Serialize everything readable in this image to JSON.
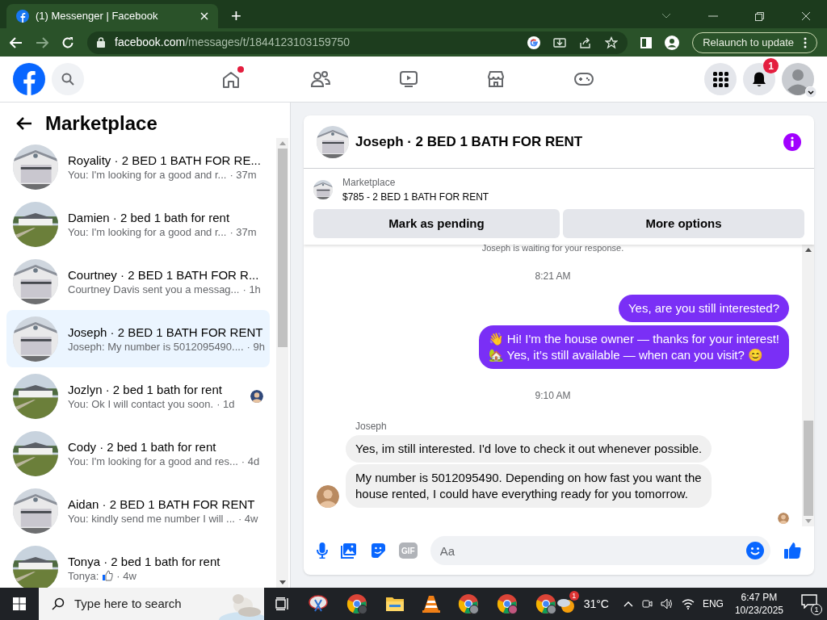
{
  "browser": {
    "tab_title": "(1) Messenger | Facebook",
    "new_tab": "+",
    "url_host": "facebook.com",
    "url_path": "/messages/t/1844123103159750",
    "relaunch": "Relaunch to update"
  },
  "header": {
    "notification_count": "1"
  },
  "sidebar": {
    "title": "Marketplace",
    "conversations": [
      {
        "title": "Royality · 2 BED 1 BATH FOR RE...",
        "preview": "You: I'm looking for a good and r...",
        "time": "· 37m",
        "selected": false,
        "read_receipt": false
      },
      {
        "title": "Damien · 2 bed 1 bath for rent",
        "preview": "You: I'm looking for a good and r...",
        "time": "· 37m",
        "selected": false,
        "read_receipt": false
      },
      {
        "title": "Courtney · 2 BED 1 BATH FOR R...",
        "preview": "Courtney Davis sent you a messag...",
        "time": "· 1h",
        "selected": false,
        "read_receipt": false
      },
      {
        "title": "Joseph · 2 BED 1 BATH FOR RENT",
        "preview": "Joseph: My number is 5012095490....",
        "time": "· 9h",
        "selected": true,
        "read_receipt": false
      },
      {
        "title": "Jozlyn · 2 bed 1 bath for rent",
        "preview": "You: Ok I will contact you soon.",
        "time": "· 1d",
        "selected": false,
        "read_receipt": true
      },
      {
        "title": "Cody · 2 bed 1 bath for rent",
        "preview": "You: I'm looking for a good and res...",
        "time": "· 4d",
        "selected": false,
        "read_receipt": false
      },
      {
        "title": "Aidan · 2 BED 1 BATH FOR RENT",
        "preview": "You: kindly send me number I will ...",
        "time": "· 4w",
        "selected": false,
        "read_receipt": false
      },
      {
        "title": "Tonya · 2 bed 1 bath for rent",
        "preview": "Tonya:",
        "kind": "like",
        "time": "· 4w",
        "selected": false,
        "read_receipt": false
      }
    ]
  },
  "chat": {
    "title": "Joseph · 2 BED 1 BATH FOR RENT",
    "listing": {
      "label": "Marketplace",
      "title": "$785 - 2 BED 1 BATH FOR RENT",
      "buttons": [
        "Mark as pending",
        "More options"
      ]
    },
    "messages": [
      {
        "kind": "notice",
        "text": "Joseph is waiting for your response."
      },
      {
        "kind": "time",
        "text": "8:21 AM"
      },
      {
        "kind": "out",
        "lines": [
          "Yes, are you still interested?"
        ]
      },
      {
        "kind": "out",
        "lines": [
          "👋 Hi! I'm the house owner — thanks for your interest!",
          "🏡 Yes, it’s still available — when can you visit? 😊"
        ]
      },
      {
        "kind": "time",
        "text": "9:10 AM"
      },
      {
        "kind": "sender",
        "text": "Joseph"
      },
      {
        "kind": "in",
        "lines": [
          "Yes, im still interested. I'd love to check it out whenever possible."
        ]
      },
      {
        "kind": "in",
        "lines": [
          "My number is 5012095490. Depending on how fast you want the",
          "house rented, I could have everything ready for you tomorrow."
        ],
        "avatar": true
      }
    ],
    "gif": "GIF",
    "placeholder": "Aa"
  },
  "taskbar": {
    "search": "Type here to search",
    "weather_badge": "1",
    "temperature": "31°C",
    "language": "ENG",
    "time": "6:47 PM",
    "date": "10/23/2025",
    "notification_count": "1"
  }
}
